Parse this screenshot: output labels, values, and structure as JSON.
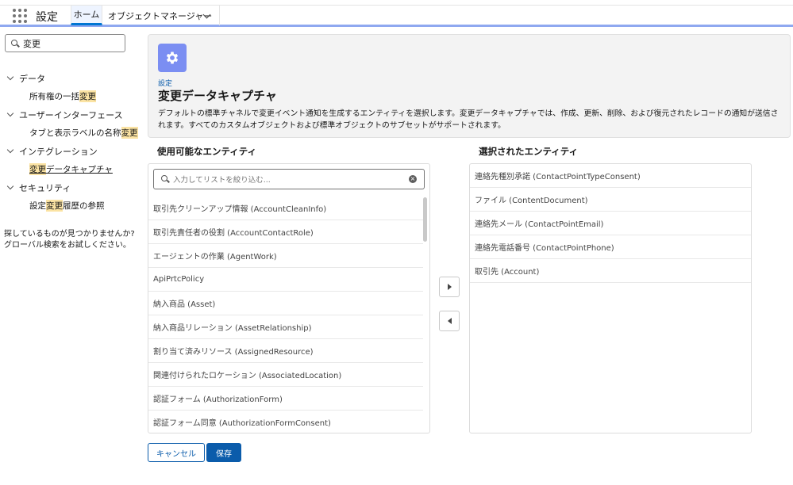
{
  "topbar": {
    "app_title": "設定",
    "tabs": [
      {
        "label": "ホーム"
      },
      {
        "label": "オブジェクトマネージャー"
      }
    ],
    "icons": {
      "launcher": "app-launcher-icon",
      "dropdown": "chevron-down-icon"
    }
  },
  "sidebar": {
    "search_value": "変更",
    "sections": [
      {
        "label": "データ",
        "children": [
          {
            "before": "所有権の一括",
            "match": "変更",
            "after": ""
          }
        ]
      },
      {
        "label": "ユーザーインターフェース",
        "children": [
          {
            "before": "タブと表示ラベルの名称",
            "match": "変更",
            "after": ""
          }
        ]
      },
      {
        "label": "インテグレーション",
        "children": [
          {
            "before": "",
            "match": "変更",
            "after": "データキャプチャ"
          }
        ]
      },
      {
        "label": "セキュリティ",
        "children": [
          {
            "before": "設定",
            "match": "変更",
            "after": "履歴の参照"
          }
        ]
      }
    ],
    "help_line1": "探しているものが見つかりませんか?",
    "help_line2": "グローバル検索をお試しください。"
  },
  "header": {
    "breadcrumb": "設定",
    "title": "変更データキャプチャ",
    "description": "デフォルトの標準チャネルで変更イベント通知を生成するエンティティを選択します。変更データキャプチャでは、作成、更新、削除、および復元されたレコードの通知が送信されます。すべてのカスタムオブジェクトおよび標準オブジェクトのサブセットがサポートされます。",
    "icon": "gear-icon",
    "tile_color": "#7b8ef2"
  },
  "available": {
    "label": "使用可能なエンティティ",
    "filter_placeholder": "入力してリストを絞り込む...",
    "items": [
      "取引先クリーンアップ情報 (AccountCleanInfo)",
      "取引先責任者の役割 (AccountContactRole)",
      "エージェントの作業 (AgentWork)",
      "ApiPrtcPolicy",
      "納入商品 (Asset)",
      "納入商品リレーション (AssetRelationship)",
      "割り当て済みリソース (AssignedResource)",
      "関連付けられたロケーション (AssociatedLocation)",
      "認証フォーム (AuthorizationForm)",
      "認証フォーム同意 (AuthorizationFormConsent)"
    ]
  },
  "selected": {
    "label": "選択されたエンティティ",
    "items": [
      "連絡先種別承諾 (ContactPointTypeConsent)",
      "ファイル (ContentDocument)",
      "連絡先メール (ContactPointEmail)",
      "連絡先電話番号 (ContactPointPhone)",
      "取引先 (Account)"
    ]
  },
  "actions": {
    "cancel": "キャンセル",
    "save": "保存",
    "move_right_icon": "move-right-icon",
    "move_left_icon": "move-left-icon"
  },
  "colors": {
    "brand": "#0b5cab",
    "highlight": "#fbe3a3"
  }
}
